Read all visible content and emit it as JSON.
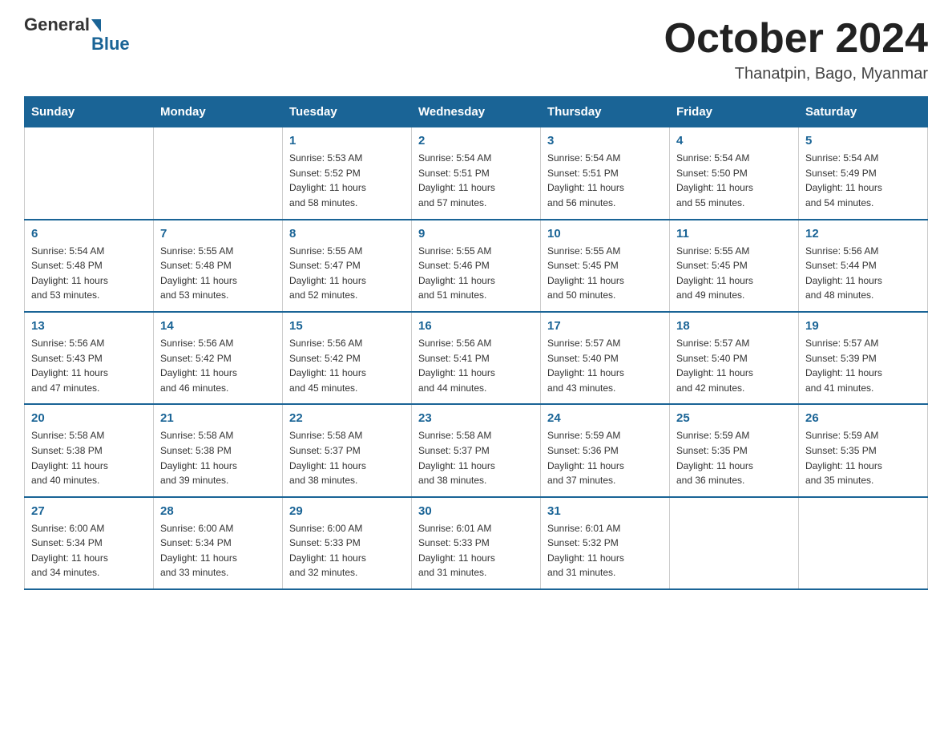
{
  "header": {
    "logo_general": "General",
    "logo_blue": "Blue",
    "month_title": "October 2024",
    "subtitle": "Thanatpin, Bago, Myanmar"
  },
  "days_of_week": [
    "Sunday",
    "Monday",
    "Tuesday",
    "Wednesday",
    "Thursday",
    "Friday",
    "Saturday"
  ],
  "weeks": [
    [
      {
        "day": "",
        "info": ""
      },
      {
        "day": "",
        "info": ""
      },
      {
        "day": "1",
        "info": "Sunrise: 5:53 AM\nSunset: 5:52 PM\nDaylight: 11 hours\nand 58 minutes."
      },
      {
        "day": "2",
        "info": "Sunrise: 5:54 AM\nSunset: 5:51 PM\nDaylight: 11 hours\nand 57 minutes."
      },
      {
        "day": "3",
        "info": "Sunrise: 5:54 AM\nSunset: 5:51 PM\nDaylight: 11 hours\nand 56 minutes."
      },
      {
        "day": "4",
        "info": "Sunrise: 5:54 AM\nSunset: 5:50 PM\nDaylight: 11 hours\nand 55 minutes."
      },
      {
        "day": "5",
        "info": "Sunrise: 5:54 AM\nSunset: 5:49 PM\nDaylight: 11 hours\nand 54 minutes."
      }
    ],
    [
      {
        "day": "6",
        "info": "Sunrise: 5:54 AM\nSunset: 5:48 PM\nDaylight: 11 hours\nand 53 minutes."
      },
      {
        "day": "7",
        "info": "Sunrise: 5:55 AM\nSunset: 5:48 PM\nDaylight: 11 hours\nand 53 minutes."
      },
      {
        "day": "8",
        "info": "Sunrise: 5:55 AM\nSunset: 5:47 PM\nDaylight: 11 hours\nand 52 minutes."
      },
      {
        "day": "9",
        "info": "Sunrise: 5:55 AM\nSunset: 5:46 PM\nDaylight: 11 hours\nand 51 minutes."
      },
      {
        "day": "10",
        "info": "Sunrise: 5:55 AM\nSunset: 5:45 PM\nDaylight: 11 hours\nand 50 minutes."
      },
      {
        "day": "11",
        "info": "Sunrise: 5:55 AM\nSunset: 5:45 PM\nDaylight: 11 hours\nand 49 minutes."
      },
      {
        "day": "12",
        "info": "Sunrise: 5:56 AM\nSunset: 5:44 PM\nDaylight: 11 hours\nand 48 minutes."
      }
    ],
    [
      {
        "day": "13",
        "info": "Sunrise: 5:56 AM\nSunset: 5:43 PM\nDaylight: 11 hours\nand 47 minutes."
      },
      {
        "day": "14",
        "info": "Sunrise: 5:56 AM\nSunset: 5:42 PM\nDaylight: 11 hours\nand 46 minutes."
      },
      {
        "day": "15",
        "info": "Sunrise: 5:56 AM\nSunset: 5:42 PM\nDaylight: 11 hours\nand 45 minutes."
      },
      {
        "day": "16",
        "info": "Sunrise: 5:56 AM\nSunset: 5:41 PM\nDaylight: 11 hours\nand 44 minutes."
      },
      {
        "day": "17",
        "info": "Sunrise: 5:57 AM\nSunset: 5:40 PM\nDaylight: 11 hours\nand 43 minutes."
      },
      {
        "day": "18",
        "info": "Sunrise: 5:57 AM\nSunset: 5:40 PM\nDaylight: 11 hours\nand 42 minutes."
      },
      {
        "day": "19",
        "info": "Sunrise: 5:57 AM\nSunset: 5:39 PM\nDaylight: 11 hours\nand 41 minutes."
      }
    ],
    [
      {
        "day": "20",
        "info": "Sunrise: 5:58 AM\nSunset: 5:38 PM\nDaylight: 11 hours\nand 40 minutes."
      },
      {
        "day": "21",
        "info": "Sunrise: 5:58 AM\nSunset: 5:38 PM\nDaylight: 11 hours\nand 39 minutes."
      },
      {
        "day": "22",
        "info": "Sunrise: 5:58 AM\nSunset: 5:37 PM\nDaylight: 11 hours\nand 38 minutes."
      },
      {
        "day": "23",
        "info": "Sunrise: 5:58 AM\nSunset: 5:37 PM\nDaylight: 11 hours\nand 38 minutes."
      },
      {
        "day": "24",
        "info": "Sunrise: 5:59 AM\nSunset: 5:36 PM\nDaylight: 11 hours\nand 37 minutes."
      },
      {
        "day": "25",
        "info": "Sunrise: 5:59 AM\nSunset: 5:35 PM\nDaylight: 11 hours\nand 36 minutes."
      },
      {
        "day": "26",
        "info": "Sunrise: 5:59 AM\nSunset: 5:35 PM\nDaylight: 11 hours\nand 35 minutes."
      }
    ],
    [
      {
        "day": "27",
        "info": "Sunrise: 6:00 AM\nSunset: 5:34 PM\nDaylight: 11 hours\nand 34 minutes."
      },
      {
        "day": "28",
        "info": "Sunrise: 6:00 AM\nSunset: 5:34 PM\nDaylight: 11 hours\nand 33 minutes."
      },
      {
        "day": "29",
        "info": "Sunrise: 6:00 AM\nSunset: 5:33 PM\nDaylight: 11 hours\nand 32 minutes."
      },
      {
        "day": "30",
        "info": "Sunrise: 6:01 AM\nSunset: 5:33 PM\nDaylight: 11 hours\nand 31 minutes."
      },
      {
        "day": "31",
        "info": "Sunrise: 6:01 AM\nSunset: 5:32 PM\nDaylight: 11 hours\nand 31 minutes."
      },
      {
        "day": "",
        "info": ""
      },
      {
        "day": "",
        "info": ""
      }
    ]
  ]
}
